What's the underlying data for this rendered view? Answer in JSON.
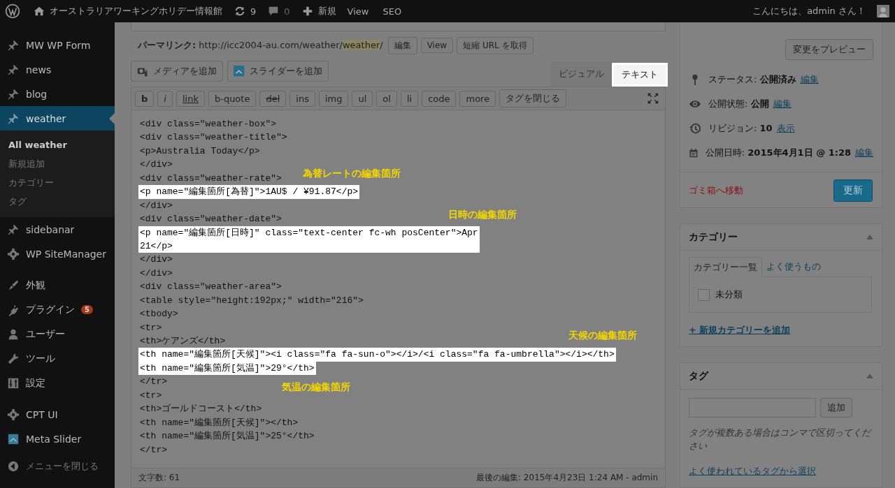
{
  "admin_bar": {
    "site_name": "オーストラリアワーキングホリデー情報館",
    "updates": "9",
    "comments": "0",
    "new_label": "新規",
    "links": [
      "View",
      "SEO"
    ],
    "greeting": "こんにちは、admin さん！"
  },
  "sidebar": {
    "groups": [
      [
        {
          "label": "MW WP Form",
          "selected": false
        },
        {
          "label": "news",
          "selected": false
        },
        {
          "label": "blog",
          "selected": false
        },
        {
          "label": "weather",
          "selected": true,
          "children": [
            {
              "label": "All weather",
              "selected": true
            },
            {
              "label": "新規追加",
              "selected": false
            },
            {
              "label": "カテゴリー",
              "selected": false
            },
            {
              "label": "タグ",
              "selected": false
            }
          ]
        },
        {
          "label": "sidebanar",
          "selected": false
        },
        {
          "label": "WP SiteManager",
          "selected": false
        }
      ],
      [
        {
          "label": "外観",
          "selected": false
        },
        {
          "label": "プラグイン",
          "selected": false,
          "badge": "5"
        },
        {
          "label": "ユーザー",
          "selected": false
        },
        {
          "label": "ツール",
          "selected": false
        },
        {
          "label": "設定",
          "selected": false
        }
      ],
      [
        {
          "label": "CPT UI",
          "selected": false
        },
        {
          "label": "Meta Slider",
          "selected": false
        }
      ]
    ],
    "collapse_label": "メニューを閉じる"
  },
  "editor": {
    "permalink_label": "パーマリンク:",
    "permalink_base": "http://icc2004-au.com/weather/",
    "permalink_slug": "weather",
    "permalink_tail": "/",
    "permalink_buttons": [
      "編集",
      "View",
      "短縮 URL を取得"
    ],
    "media_buttons": [
      "メディアを追加",
      "スライダーを追加"
    ],
    "tabs": [
      {
        "label": "ビジュアル",
        "selected": false
      },
      {
        "label": "テキスト",
        "selected": true
      }
    ],
    "quicktags": [
      {
        "label": "b",
        "kind": "bold"
      },
      {
        "label": "i",
        "kind": "italic"
      },
      {
        "label": "link",
        "kind": "underline"
      },
      {
        "label": "b-quote",
        "kind": "plain"
      },
      {
        "label": "del",
        "kind": "strike"
      },
      {
        "label": "ins",
        "kind": "plain"
      },
      {
        "label": "img",
        "kind": "plain"
      },
      {
        "label": "ul",
        "kind": "plain"
      },
      {
        "label": "ol",
        "kind": "plain"
      },
      {
        "label": "li",
        "kind": "plain"
      },
      {
        "label": "code",
        "kind": "plain"
      },
      {
        "label": "more",
        "kind": "plain"
      },
      {
        "label": "タグを閉じる",
        "kind": "plain"
      }
    ],
    "code": [
      {
        "lines": [
          "<div class=\"weather-box\">"
        ],
        "highlighted": false
      },
      {
        "lines": [
          "<div class=\"weather-title\">"
        ],
        "highlighted": false
      },
      {
        "lines": [
          "<p>Australia Today</p>"
        ],
        "highlighted": false
      },
      {
        "lines": [
          "</div>"
        ],
        "highlighted": false
      },
      {
        "lines": [
          "<div class=\"weather-rate\">"
        ],
        "highlighted": false
      },
      {
        "lines": [
          "<p name=\"編集箇所[為替]\">1AU$ / ¥91.87</p>"
        ],
        "highlighted": true
      },
      {
        "lines": [
          "</div>"
        ],
        "highlighted": false
      },
      {
        "lines": [
          "<div class=\"weather-date\">"
        ],
        "highlighted": false
      },
      {
        "lines": [
          "<p name=\"編集箇所[日時]\" class=\"text-center fc-wh posCenter\">Apr",
          "21</p>"
        ],
        "highlighted": true
      },
      {
        "lines": [
          "</div>"
        ],
        "highlighted": false
      },
      {
        "lines": [
          "</div>"
        ],
        "highlighted": false
      },
      {
        "lines": [
          "<div class=\"weather-area\">"
        ],
        "highlighted": false
      },
      {
        "lines": [
          "<table style=\"height:192px;\" width=\"216\">"
        ],
        "highlighted": false
      },
      {
        "lines": [
          "<tbody>"
        ],
        "highlighted": false
      },
      {
        "lines": [
          "<tr>"
        ],
        "highlighted": false
      },
      {
        "lines": [
          "<th>ケアンズ</th>"
        ],
        "highlighted": false
      },
      {
        "lines": [
          "<th name=\"編集箇所[天候]\"><i class=\"fa fa-sun-o\"></i>/<i class=\"fa fa-umbrella\"></i></th>"
        ],
        "highlighted": true
      },
      {
        "lines": [
          "<th name=\"編集箇所[気温]\">29°</th>"
        ],
        "highlighted": true
      },
      {
        "lines": [
          "</tr>"
        ],
        "highlighted": false
      },
      {
        "lines": [
          "<tr>"
        ],
        "highlighted": false
      },
      {
        "lines": [
          "<th>ゴールドコースト</th>"
        ],
        "highlighted": false
      },
      {
        "lines": [
          "<th name=\"編集箇所[天候]\"></th>"
        ],
        "highlighted": false
      },
      {
        "lines": [
          "<th name=\"編集箇所[気温]\">25°</th>"
        ],
        "highlighted": false
      },
      {
        "lines": [
          "</tr>"
        ],
        "highlighted": false
      }
    ],
    "annotations": [
      "為替レートの編集箇所",
      "日時の編集箇所",
      "天候の編集箇所",
      "気温の編集箇所"
    ],
    "word_count": "文字数: 61",
    "last_edited": "最後の編集: 2015年4月23日 1:24 AM - admin"
  },
  "publish": {
    "preview_button": "変更をプレビュー",
    "rows": [
      {
        "label": "ステータス:",
        "value": "公開済み",
        "link": "編集"
      },
      {
        "label": "公開状態:",
        "value": "公開",
        "link": "編集"
      },
      {
        "label": "リビジョン:",
        "value": "10",
        "link": "表示"
      },
      {
        "label": "公開日時:",
        "value": "2015年4月1日 @ 1:28",
        "link": "編集"
      }
    ],
    "trash_link": "ゴミ箱へ移動",
    "update_button": "更新"
  },
  "categories": {
    "title": "カテゴリー",
    "tabs": [
      {
        "label": "カテゴリー一覧",
        "selected": true
      },
      {
        "label": "よく使うもの",
        "selected": false
      }
    ],
    "items": [
      {
        "label": "未分類",
        "checked": false
      }
    ],
    "add_link": "+ 新規カテゴリーを追加"
  },
  "tags": {
    "title": "タグ",
    "add_button": "追加",
    "hint": "タグが複数ある場合はコンマで区切ってください",
    "popular_link": "よく使われているタグから選択"
  }
}
